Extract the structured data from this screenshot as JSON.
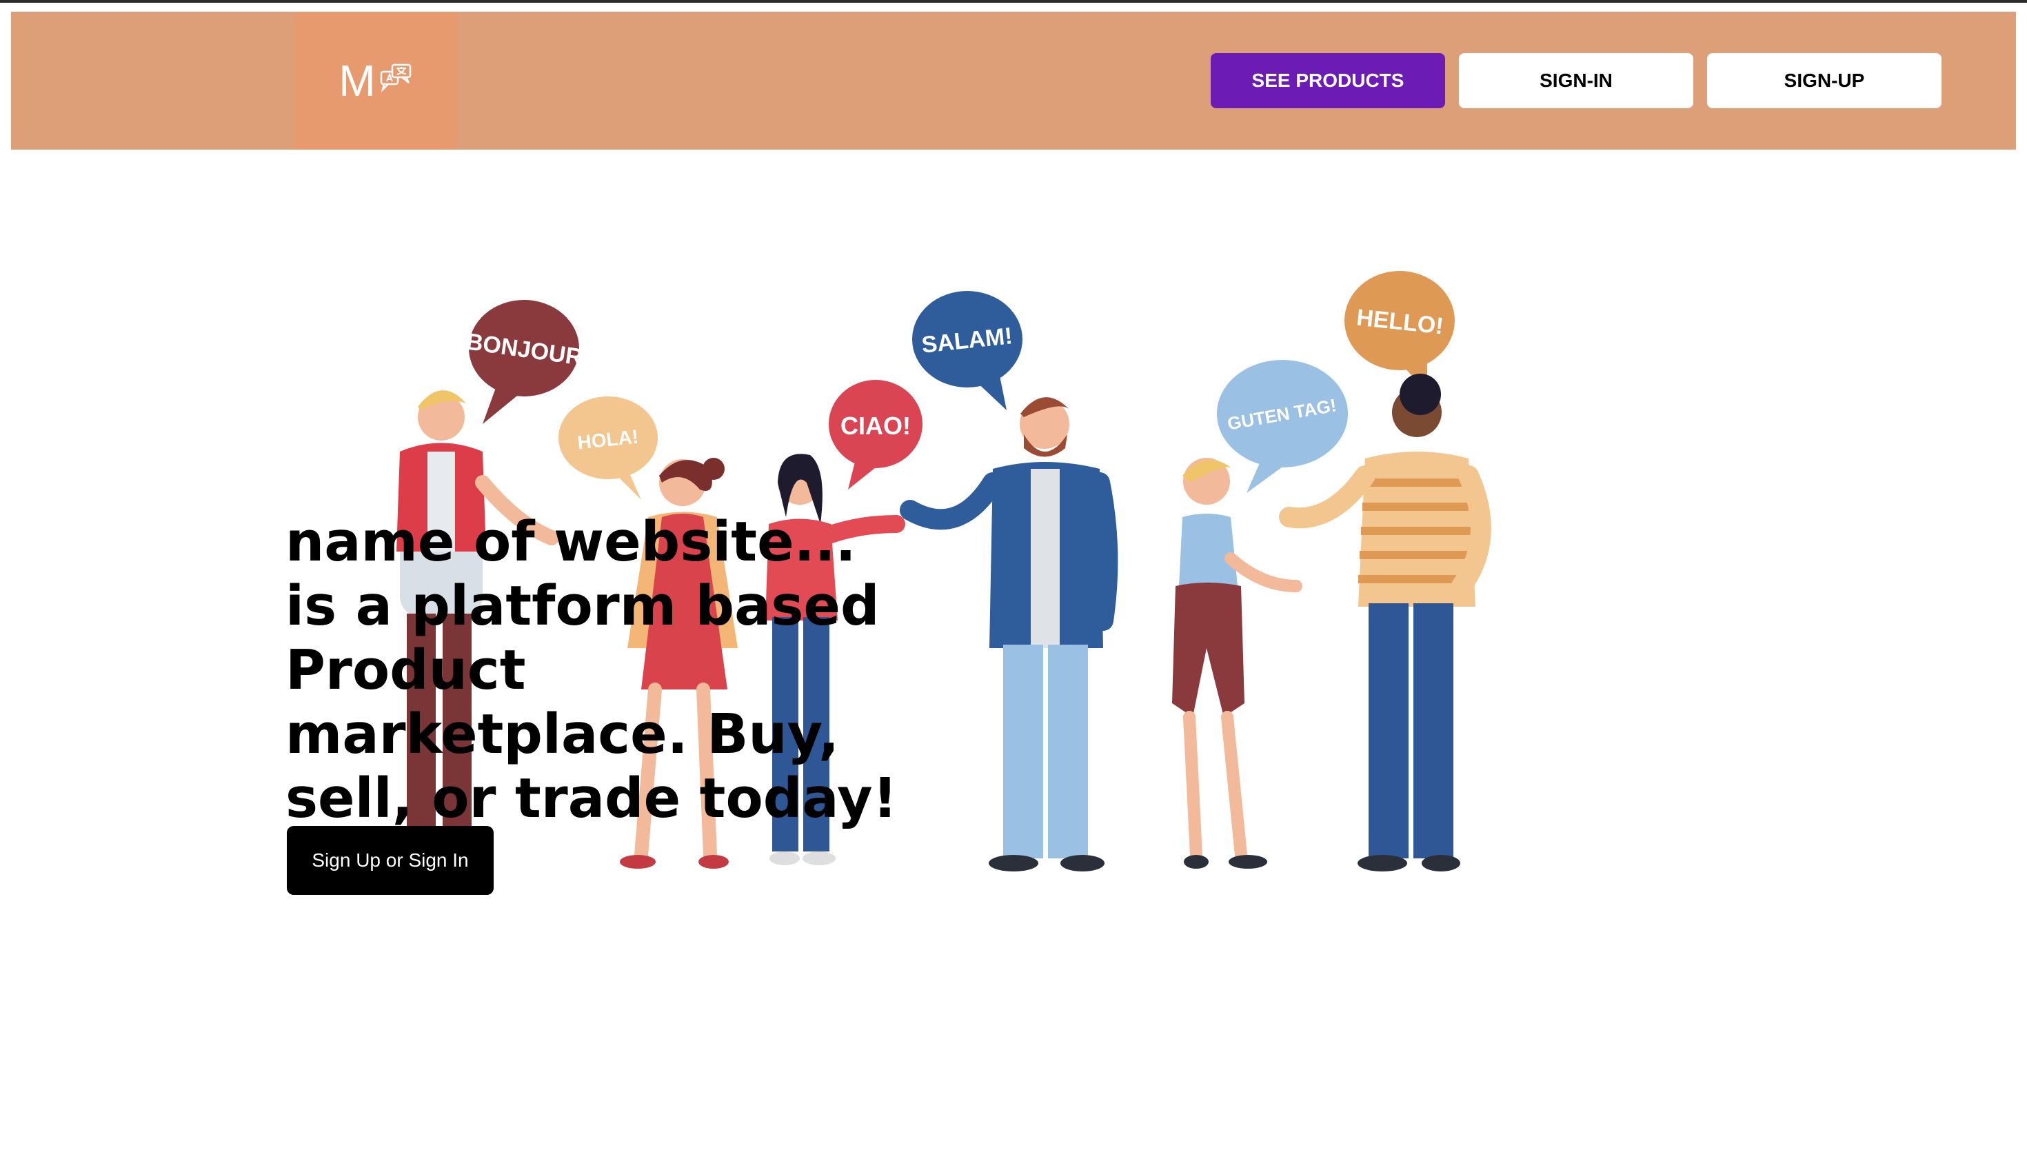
{
  "header": {
    "logo_letter": "M",
    "buttons": {
      "see_products": "SEE PRODUCTS",
      "sign_in": "SIGN-IN",
      "sign_up": "SIGN-UP"
    }
  },
  "hero": {
    "headline": "name of website... is a platform based Product marketplace. Buy, sell, or trade today!",
    "cta": "Sign Up or Sign In",
    "speech_bubbles": [
      "BONJOUR",
      "HOLA!",
      "CIAO!",
      "SALAM!",
      "GUTEN TAG!",
      "HELLO!"
    ]
  },
  "colors": {
    "navbar": "#dd9f77",
    "logo_box": "#e69a6e",
    "primary_button": "#6c1bb5",
    "cta_button": "#000000"
  },
  "icons": {
    "logo": "translate-chat-icon"
  }
}
